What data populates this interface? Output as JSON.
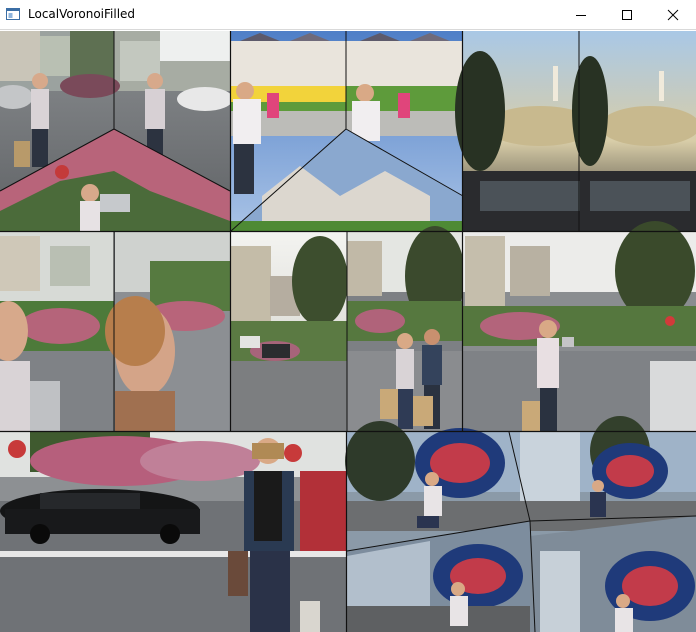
{
  "window": {
    "title": "LocalVoronoiFilled",
    "controls": {
      "minimize": "minimize-icon",
      "maximize": "maximize-icon",
      "close": "close-icon"
    }
  },
  "mosaic": {
    "photos": [
      {
        "name": "photo-lombard-street-woman-split",
        "subject": "woman standing on street corner, split into voronoi cells"
      },
      {
        "name": "photo-painted-ladies",
        "subject": "painted ladies houses with woman in foreground"
      },
      {
        "name": "photo-coit-tower",
        "subject": "coit tower hill view from car"
      },
      {
        "name": "photo-lombard-closeup",
        "subject": "close-up of woman on lombard street"
      },
      {
        "name": "photo-lombard-hedge",
        "subject": "lombard street hedges and houses"
      },
      {
        "name": "photo-two-people",
        "subject": "two people standing on lombard street"
      },
      {
        "name": "photo-woman-crossing",
        "subject": "woman on street crossing"
      },
      {
        "name": "photo-town-car-woman",
        "subject": "black town car and woman in scarf"
      },
      {
        "name": "photo-hearts-sculpture",
        "subject": "woman seated by heart sculpture, voronoi split"
      }
    ]
  }
}
